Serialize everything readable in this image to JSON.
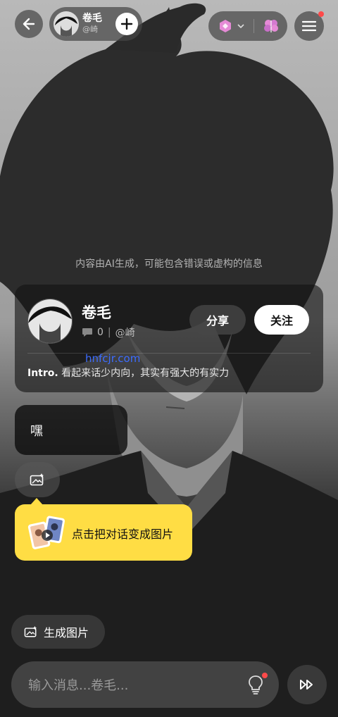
{
  "header": {
    "character_name": "卷毛",
    "character_handle": "@崎",
    "has_notification": true,
    "icons": [
      "back-arrow-icon",
      "plus-icon",
      "model-gem-icon",
      "chevron-down-icon",
      "brain-icon",
      "menu-icon"
    ]
  },
  "disclaimer": "内容由AI生成，可能包含错误或虚构的信息",
  "profile_card": {
    "name": "卷毛",
    "chat_count": "0",
    "handle": "@崎",
    "share_label": "分享",
    "follow_label": "关注",
    "intro_label": "Intro.",
    "intro_text": "看起来话少内向，其实有强大的有实力"
  },
  "watermark": "hnfcjr.com",
  "messages": [
    {
      "role": "character",
      "text": "嘿"
    }
  ],
  "tooltip": {
    "text": "点击把对话变成图片"
  },
  "generate_image_label": "生成图片",
  "composer": {
    "placeholder": "输入消息...卷毛..."
  },
  "colors": {
    "accent_yellow": "#ffdd44",
    "notification_red": "#ff4a4a",
    "watermark_blue": "#3c6cff",
    "gem_pink": "#e58ad6"
  }
}
